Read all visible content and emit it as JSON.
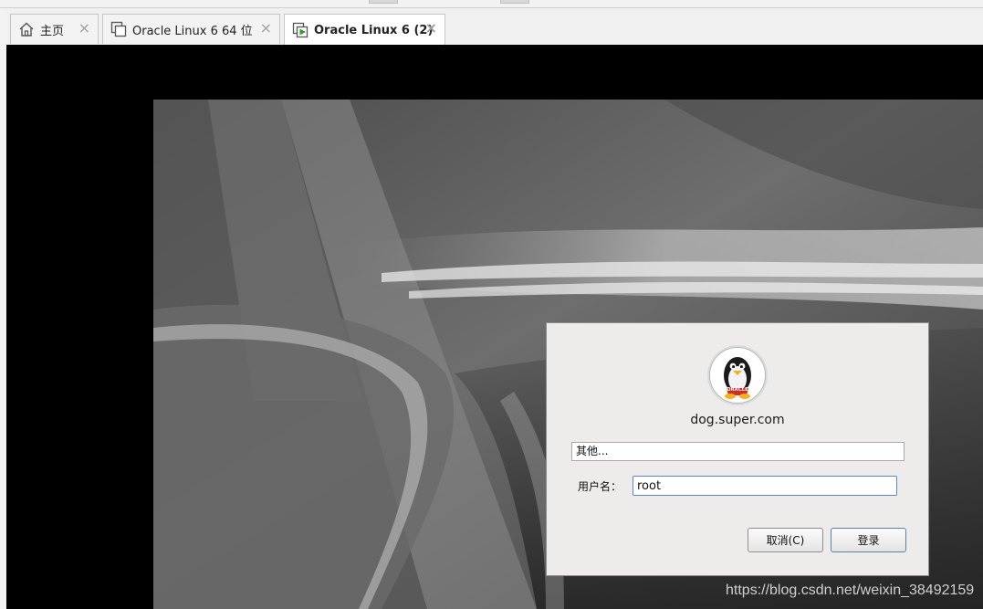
{
  "tabs": [
    {
      "label": "主页",
      "icon": "home-icon",
      "active": false
    },
    {
      "label": "Oracle Linux 6 64 位",
      "icon": "vm-icon",
      "active": false
    },
    {
      "label": "Oracle Linux 6 (2)",
      "icon": "vm-running-icon",
      "active": true
    }
  ],
  "login": {
    "avatar_brand": "ORACLE",
    "hostname": "dog.super.com",
    "user_list_item": "其他...",
    "username_label": "用户名：",
    "username_value": "root",
    "cancel_label": "取消(C)",
    "login_label": "登录"
  },
  "watermark": "https://blog.csdn.net/weixin_38492159",
  "colors": {
    "console_bg": "#000000",
    "dialog_bg": "#edeceb",
    "input_focus": "#5b87c6",
    "run_green": "#2e9e2e"
  }
}
